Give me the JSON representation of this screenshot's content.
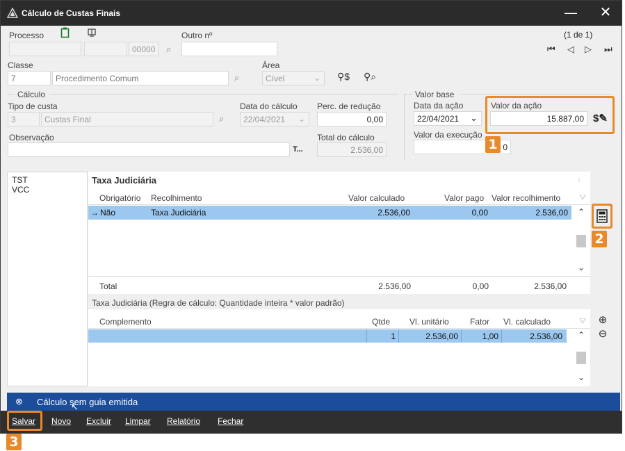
{
  "window": {
    "title": "Cálculo de Custas Finais",
    "minimize": "—",
    "close": "✕"
  },
  "processo": {
    "label": "Processo",
    "num_suffix": "00000",
    "outro_label": "Outro nº",
    "pager": "(1 de 1)"
  },
  "classe": {
    "label": "Classe",
    "code": "7",
    "name": "Procedimento Comum"
  },
  "area": {
    "label": "Área",
    "value": "Cível"
  },
  "calculo": {
    "section": "Cálculo",
    "tipo_label": "Tipo de custa",
    "tipo_code": "3",
    "tipo_name": "Custas Final",
    "data_calc_label": "Data do cálculo",
    "data_calc_value": "22/04/2021",
    "perc_label": "Perc. de redução",
    "perc_value": "0,00",
    "obs_label": "Observação",
    "obs_btn": "T...",
    "total_label": "Total do cálculo",
    "total_value": "2.536,00"
  },
  "valor_base": {
    "section": "Valor base",
    "data_acao_label": "Data da ação",
    "data_acao_value": "22/04/2021",
    "valor_acao_label": "Valor da ação",
    "valor_acao_value": "15.887,00",
    "valor_exec_label": "Valor da execução",
    "valor_exec_value": "0"
  },
  "left_list": [
    "TST",
    "VCC"
  ],
  "taxa": {
    "title": "Taxa Judiciária",
    "headers": {
      "obrigatorio": "Obrigatório",
      "recolhimento": "Recolhimento",
      "valor_calculado": "Valor calculado",
      "valor_pago": "Valor pago",
      "valor_recolhimento": "Valor recolhimento"
    },
    "row": {
      "arrow": "→",
      "obrigatorio": "Não",
      "recolhimento": "Taxa Judiciária",
      "valor_calculado": "2.536,00",
      "valor_pago": "0,00",
      "valor_recolhimento": "2.536,00"
    },
    "total": {
      "label": "Total",
      "valor_calculado": "2.536,00",
      "valor_pago": "0,00",
      "valor_recolhimento": "2.536,00"
    }
  },
  "regra": {
    "title": "Taxa Judiciária (Regra de cálculo: Quantidade inteira * valor padrão)",
    "headers": {
      "complemento": "Complemento",
      "qtde": "Qtde",
      "vl_unitario": "Vl. unitário",
      "fator": "Fator",
      "vl_calculado": "Vl. calculado"
    },
    "row": {
      "qtde": "1",
      "vl_unitario": "2.536,00",
      "fator": "1,00",
      "vl_calculado": "2.536,00"
    }
  },
  "status": {
    "text": "Cálculo sem guia emitida"
  },
  "footer": {
    "salvar": "Salvar",
    "novo": "Novo",
    "excluir": "Excluir",
    "limpar": "Limpar",
    "relatorio": "Relatório",
    "fechar": "Fechar"
  },
  "badges": [
    "1",
    "2",
    "3"
  ],
  "colors": {
    "accent": "#e8892a",
    "status_bar": "#1b4d9b",
    "selection": "#9cc8f0"
  }
}
